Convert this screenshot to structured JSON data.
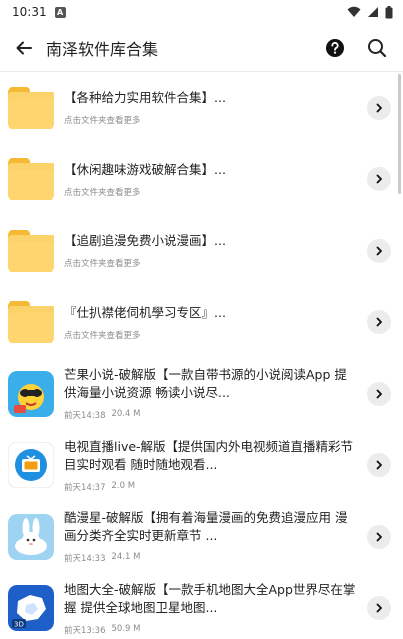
{
  "status": {
    "time": "10:31"
  },
  "header": {
    "title": "南泽软件库合集"
  },
  "items": [
    {
      "type": "folder",
      "name": "【各种给力实用软件合集】...",
      "meta": "点击文件夹查看更多"
    },
    {
      "type": "folder",
      "name": "【休闲趣味游戏破解合集】...",
      "meta": "点击文件夹查看更多"
    },
    {
      "type": "folder",
      "name": "【追剧追漫免费小说漫画】...",
      "meta": "点击文件夹查看更多"
    },
    {
      "type": "folder",
      "name": "『仕扒襟佬伺机學习专区』...",
      "meta": "点击文件夹查看更多"
    },
    {
      "type": "app",
      "name": "芒果小说-破解版【一款自带书源的小说阅读App 提供海量小说资源 畅读小说尽...",
      "date": "前天14:38",
      "size": "20.4 M"
    },
    {
      "type": "app",
      "name": "电视直播live-解版【提供国内外电视频道直播精彩节目实时观看 随时随地观看...",
      "date": "前天14:37",
      "size": "2.0 M"
    },
    {
      "type": "app",
      "name": "酷漫星-破解版【拥有着海量漫画的免费追漫应用 漫画分类齐全实时更新章节 ...",
      "date": "前天14:33",
      "size": "24.1 M"
    },
    {
      "type": "app",
      "name": "地图大全-破解版【一款手机地图大全App世界尽在掌握 提供全球地图卫星地图...",
      "date": "前天13:36",
      "size": "50.9 M"
    }
  ]
}
